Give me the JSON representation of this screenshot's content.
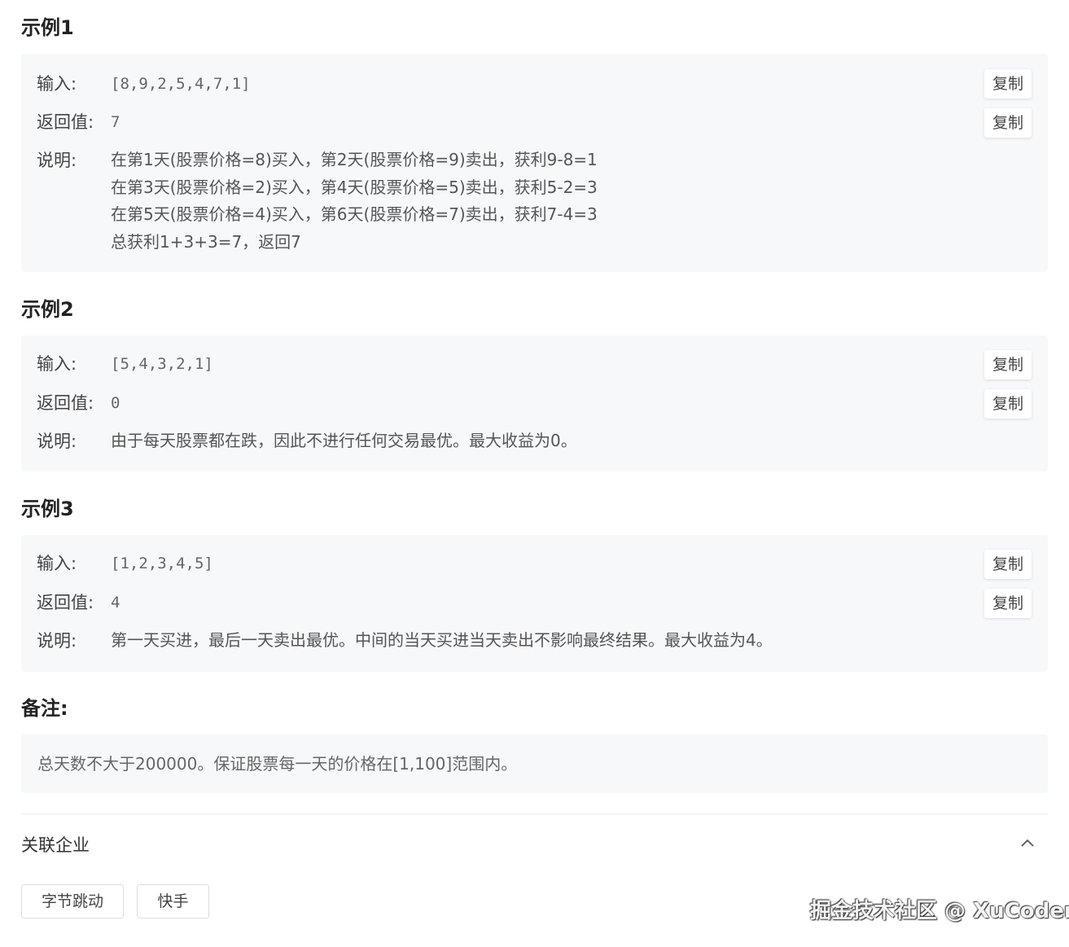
{
  "examples": [
    {
      "title": "示例1",
      "input_label": "输入:",
      "input_value": "[8,9,2,5,4,7,1]",
      "return_label": "返回值:",
      "return_value": "7",
      "explain_label": "说明:",
      "explain_lines": [
        "在第1天(股票价格=8)买入，第2天(股票价格=9)卖出，获利9-8=1",
        "在第3天(股票价格=2)买入，第4天(股票价格=5)卖出，获利5-2=3",
        "在第5天(股票价格=4)买入，第6天(股票价格=7)卖出，获利7-4=3",
        "总获利1+3+3=7，返回7"
      ],
      "copy_label": "复制"
    },
    {
      "title": "示例2",
      "input_label": "输入:",
      "input_value": "[5,4,3,2,1]",
      "return_label": "返回值:",
      "return_value": "0",
      "explain_label": "说明:",
      "explain_lines": [
        "由于每天股票都在跌，因此不进行任何交易最优。最大收益为0。"
      ],
      "copy_label": "复制"
    },
    {
      "title": "示例3",
      "input_label": "输入:",
      "input_value": "[1,2,3,4,5]",
      "return_label": "返回值:",
      "return_value": "4",
      "explain_label": "说明:",
      "explain_lines": [
        "第一天买进，最后一天卖出最优。中间的当天买进当天卖出不影响最终结果。最大收益为4。"
      ],
      "copy_label": "复制"
    }
  ],
  "note": {
    "title": "备注:",
    "text": "总天数不大于200000。保证股票每一天的价格在[1,100]范围内。"
  },
  "related": {
    "title": "关联企业",
    "tags": [
      "字节跳动",
      "快手"
    ],
    "chevron_icon": "chevron-up-icon"
  },
  "watermark": "掘金技术社区 @ XuCoder"
}
